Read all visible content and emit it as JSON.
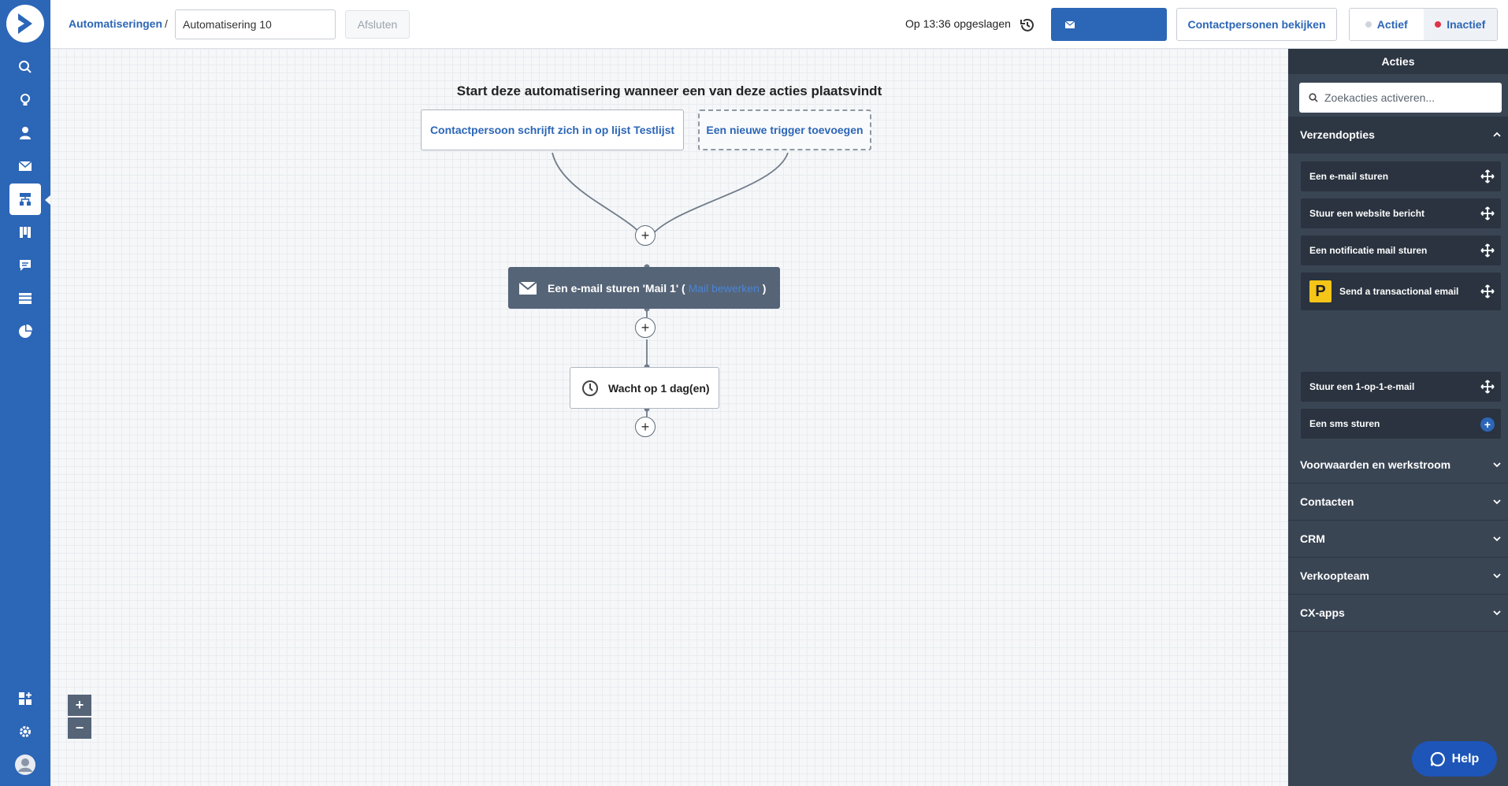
{
  "breadcrumb": {
    "root_label": "Automatiseringen",
    "separator": "/"
  },
  "automation": {
    "name": "Automatisering 10"
  },
  "header": {
    "close_label": "Afsluten",
    "saved_text": "Op 13:36 opgeslagen",
    "view_contacts_label": "Contactpersonen bekijken",
    "status": {
      "active_label": "Actief",
      "inactive_label": "Inactief",
      "selected": "Inactief"
    }
  },
  "colors": {
    "brand": "#2c66b7",
    "panel": "#3a4554",
    "active_dot": "#d0d5db",
    "inactive_dot": "#e0334a",
    "node_dark": "#556477",
    "accent_logo": "#f5c518"
  },
  "canvas": {
    "heading": "Start deze automatisering wanneer een van deze acties plaatsvindt",
    "triggers": [
      {
        "label": "Contactpersoon schrijft zich in op lijst Testlijst"
      },
      {
        "label": "Een nieuwe trigger toevoegen"
      }
    ],
    "email_node": {
      "label": "Een e-mail sturen 'Mail 1' (",
      "link_label": "Mail bewerken",
      "close_paren": ")"
    },
    "wait_node": {
      "label": "Wacht op 1 dag(en)"
    },
    "zoom": {
      "in": "+",
      "out": "−"
    }
  },
  "panel": {
    "title": "Acties",
    "search_placeholder": "Zoekacties activeren...",
    "sections": [
      {
        "label": "Verzendopties",
        "expanded": true
      },
      {
        "label": "Voorwaarden en werkstroom",
        "expanded": false
      },
      {
        "label": "Contacten",
        "expanded": false
      },
      {
        "label": "CRM",
        "expanded": false
      },
      {
        "label": "Verkoopteam",
        "expanded": false
      },
      {
        "label": "CX-apps",
        "expanded": false
      }
    ],
    "send_actions": [
      {
        "label": "Een e-mail sturen"
      },
      {
        "label": "Stuur een website bericht"
      },
      {
        "label": "Een notificatie mail sturen"
      },
      {
        "label": "Send a transactional email",
        "logo": "P"
      },
      {
        "label": "Stuur een 1-op-1-e-mail"
      },
      {
        "label": "Een sms sturen"
      }
    ]
  },
  "nav": {
    "icons": [
      "search-icon",
      "lightbulb-icon",
      "contacts-icon",
      "email-icon",
      "automations-icon",
      "pipelines-icon",
      "conversations-icon",
      "website-icon",
      "reports-icon",
      "apps-icon",
      "settings-icon",
      "profile-icon"
    ]
  },
  "help": {
    "label": "Help"
  }
}
